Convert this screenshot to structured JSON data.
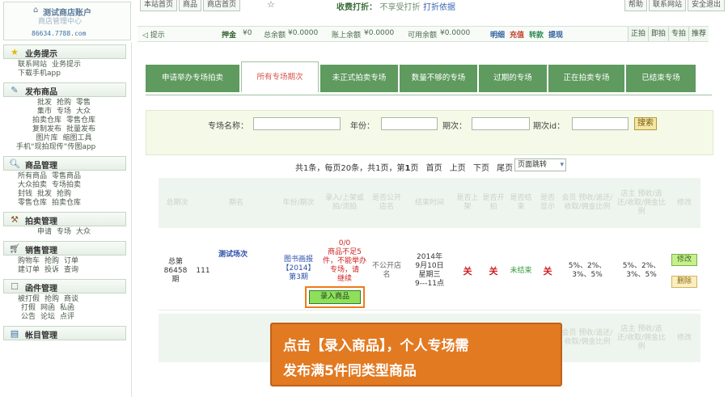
{
  "logo": {
    "title": "测试商店账户",
    "subtitle": "商店管理中心",
    "domain": "86634.7788.com"
  },
  "topnav": {
    "tabs": [
      "本站首页",
      "商品",
      "商店首页"
    ],
    "star": "☆",
    "notice_label": "收费打折：",
    "notice_text": "不享受打折",
    "notice_link": "打折依据",
    "right_links": [
      "帮助",
      "联系网站",
      "安全退出"
    ]
  },
  "infobar": {
    "hint": "提示",
    "deposit_label": "押金",
    "deposit_value": "¥0",
    "total_label": "总余额",
    "total_value": "¥0.0000",
    "account_label": "账上余额",
    "account_value": "¥0.0000",
    "avail_label": "可用余额",
    "avail_value": "¥0.0000",
    "links": [
      "明细",
      "充值",
      "转款",
      "提现"
    ],
    "buttons": [
      "正拍",
      "即拍",
      "专拍",
      "推荐"
    ]
  },
  "sidebar": {
    "sections": [
      {
        "title": "业务提示",
        "icon": "star-icon",
        "rows": [
          [
            "联系网站",
            "业务提示"
          ],
          [
            "下载手机app"
          ]
        ]
      },
      {
        "title": "发布商品",
        "icon": "edit-icon",
        "rows": [
          [
            "批发",
            "抢购",
            "零售"
          ],
          [
            "集市",
            "专场",
            "大众"
          ],
          [
            "拍卖仓库",
            "零售仓库"
          ],
          [
            "复制发布",
            "批量发布"
          ],
          [
            "图片库",
            "缩图工具"
          ],
          [
            "手机“现拍现传”传图app"
          ]
        ]
      },
      {
        "title": "商品管理",
        "icon": "magnifier-icon",
        "rows": [
          [
            "所有商品",
            "零售商品"
          ],
          [
            "大众拍卖",
            "专场拍卖"
          ],
          [
            "封钱",
            "批发",
            "抢购"
          ],
          [
            "零售仓库",
            "拍卖仓库"
          ]
        ]
      },
      {
        "title": "拍卖管理",
        "icon": "gavel-icon",
        "rows": [
          [
            "申请",
            "专场",
            "大众"
          ]
        ]
      },
      {
        "title": "销售管理",
        "icon": "cart-icon",
        "rows": [
          [
            "购物车",
            "抢购",
            "订单"
          ],
          [
            "建订单",
            "投诉",
            "查询"
          ]
        ]
      },
      {
        "title": "函件管理",
        "icon": "envelope-icon",
        "rows": [
          [
            "被打假",
            "抢购",
            "商谈"
          ],
          [
            "打假",
            "网函",
            "私函"
          ],
          [
            "公告",
            "论坛",
            "点评"
          ]
        ]
      },
      {
        "title": "帐目管理",
        "icon": "ledger-icon",
        "rows": []
      }
    ]
  },
  "tabs": [
    {
      "label": "申请举办专场拍卖",
      "active": false
    },
    {
      "label": "所有专场期次",
      "active": true
    },
    {
      "label": "未正式拍卖专场",
      "active": false
    },
    {
      "label": "数量不够的专场",
      "active": false
    },
    {
      "label": "过期的专场",
      "active": false
    },
    {
      "label": "正在拍卖专场",
      "active": false
    },
    {
      "label": "已结束专场",
      "active": false
    }
  ],
  "search": {
    "name_label": "专场名称：",
    "year_label": "年份：",
    "period_label": "期次：",
    "id_label": "期次id：",
    "button": "搜索"
  },
  "pager": {
    "summary": "共1条，每页20条，共1页，第",
    "current": "1",
    "page_suffix": "页",
    "links": [
      "首页",
      "上页",
      "下页",
      "尾页"
    ],
    "jump": "页面跳转"
  },
  "table": {
    "headers": [
      "总期次",
      "期名",
      "年份/期次",
      "录入/上架或拍/流拍",
      "是否公开店名",
      "结束时间",
      "是否上架",
      "是否开拍",
      "是否结束",
      "是否显示",
      "会员 预收/追还/收取/佣金比例",
      "店主 预收/追还/收取/佣金比例",
      "修改"
    ],
    "row": {
      "total_period_l1": "总第",
      "total_period_l2": "86458",
      "total_period_l3": "期",
      "name": "测试场次",
      "id": "111",
      "year_l1": "图书画报",
      "year_l2": "【2014】",
      "year_l3": "第3期",
      "entry_count": "0/0",
      "entry_warn": "商品不足5件，不能举办专场，请",
      "entry_warn_tail": "继续",
      "public_shop": "不公开店名",
      "end_l1": "2014年",
      "end_l2": "9月10日",
      "end_l3": "星期三",
      "end_l4": "9---11点",
      "onshelf": "关",
      "started": "关",
      "ended": "未结束",
      "shown": "关",
      "member_l1": "5%、2%、",
      "member_l2": "3%、5%",
      "owner_l1": "5%、2%、",
      "owner_l2": "3%、5%",
      "edit": "修改",
      "delete": "删除"
    },
    "entry_button": "录入商品"
  },
  "callout": {
    "line1": "点击【录入商品】，个人专场需",
    "line2": "发布满5件同类型商品"
  },
  "colors": {
    "accent_green": "#5f9a5f",
    "callout_orange": "#e27a22",
    "warning_red": "#d02020"
  }
}
